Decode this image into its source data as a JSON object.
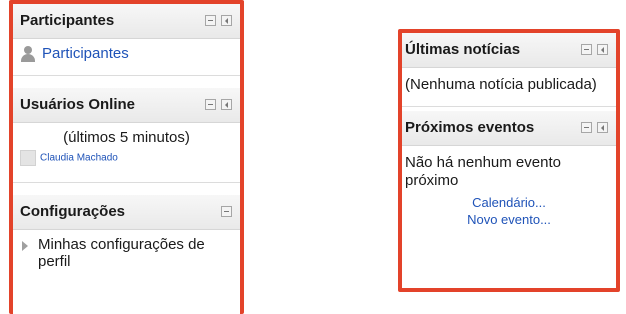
{
  "left_panel": {
    "participants_block": {
      "title": "Participantes",
      "link_label": "Participantes"
    },
    "online_block": {
      "title": "Usuários Online",
      "period": "(últimos 5 minutos)",
      "user_name": "Claudia Machado"
    },
    "settings_block": {
      "title": "Configurações",
      "item_label": "Minhas configurações de perfil"
    }
  },
  "right_panel": {
    "news_block": {
      "title": "Últimas notícias",
      "empty_text": "(Nenhuma notícia publicada)"
    },
    "events_block": {
      "title": "Próximos eventos",
      "empty_text": "Não há nenhum evento próximo",
      "calendar_link": "Calendário...",
      "new_event_link": "Novo evento..."
    }
  },
  "colors": {
    "highlight_border": "#e3432a",
    "link": "#1f53b8"
  },
  "icons": [
    "hide-block-icon",
    "dock-block-icon",
    "users-icon",
    "user-avatar-icon",
    "tree-expand-icon"
  ]
}
